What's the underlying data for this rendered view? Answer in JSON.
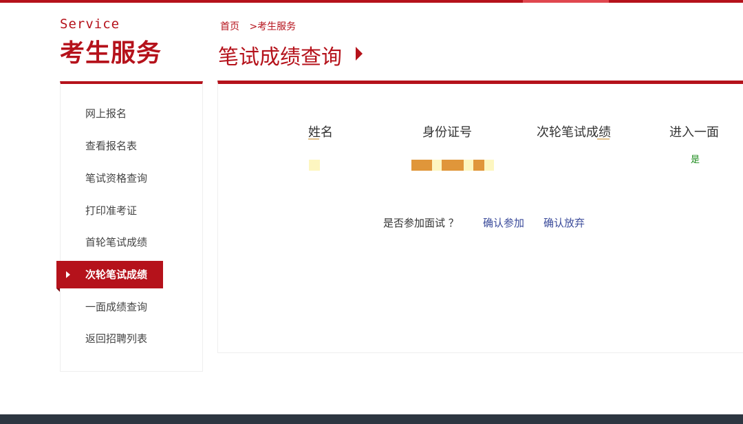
{
  "sidebar": {
    "title_en": "Service",
    "title_cn": "考生服务",
    "items": [
      {
        "label": "网上报名",
        "active": false
      },
      {
        "label": "查看报名表",
        "active": false
      },
      {
        "label": "笔试资格查询",
        "active": false
      },
      {
        "label": "打印准考证",
        "active": false
      },
      {
        "label": "首轮笔试成绩",
        "active": false
      },
      {
        "label": "次轮笔试成绩",
        "active": true
      },
      {
        "label": "一面成绩查询",
        "active": false
      },
      {
        "label": "返回招聘列表",
        "active": false
      }
    ]
  },
  "breadcrumb": {
    "home": "首页",
    "current": ">考生服务"
  },
  "page_title": "笔试成绩查询",
  "table": {
    "columns": [
      "姓名",
      "身份证号",
      "次轮笔试成绩",
      "进入一面"
    ],
    "row": {
      "name": "",
      "id_number": "",
      "score": "",
      "enter_interview": "是"
    }
  },
  "confirm": {
    "question": "是否参加面试 ？",
    "accept_label": "确认参加",
    "decline_label": "确认放弃"
  },
  "colors": {
    "brand_red": "#b5121b",
    "link_blue": "#3a4a9a",
    "yes_green": "#1a8a1a",
    "footer_dark": "#2d3641",
    "mask_orange": "#e0963a",
    "mask_yellow": "#fdf6c0"
  }
}
